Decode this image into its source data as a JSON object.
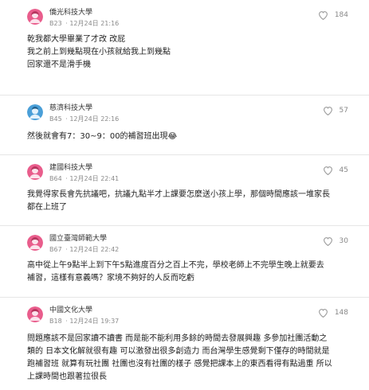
{
  "comments": [
    {
      "school": "僑光科技大學",
      "floor": "B23",
      "time": "12月24日 21:16",
      "likes": "184",
      "avatar": "pink-female-avatar",
      "lines": [
        "乾我都大學畢業了才改 改屁",
        "我之前上到幾點現在小孩就給我上到幾點",
        "回家還不是滑手機"
      ]
    },
    {
      "school": "慈濟科技大學",
      "floor": "B45",
      "time": "12月24日 22:16",
      "likes": "57",
      "avatar": "blue-male-avatar",
      "lines": [
        "然後就會有7：30~9：00的補習班出現😂"
      ]
    },
    {
      "school": "建國科技大學",
      "floor": "B64",
      "time": "12月24日 22:41",
      "likes": "45",
      "avatar": "pink-female-avatar",
      "lines": [
        "我覺得家長會先抗議吧，抗議九點半才上課要怎麼送小孩上學，那個時間應該一堆家長",
        "都在上班了"
      ]
    },
    {
      "school": "國立臺灣師範大學",
      "floor": "B67",
      "time": "12月24日 22:42",
      "likes": "30",
      "avatar": "pink-female-avatar",
      "lines": [
        "高中從上午9點半上到下午5點進度百分之百上不完，學校老師上不完學生晚上就要去",
        "補習，這樣有意義嗎？家境不夠好的人反而吃虧"
      ]
    },
    {
      "school": "中國文化大學",
      "floor": "B18",
      "time": "12月24日 19:37",
      "likes": "148",
      "avatar": "pink-female-avatar",
      "lines": [
        "問題應該不是回家讀不讀書 而是能不能利用多餘的時間去發展興趣 多參加社團活動之",
        "類的 日本文化解就很有趣 可以激發出很多創造力 而台灣學生感覺剩下僅存的時間就是",
        "跑補習班 就算有玩社團 社團也沒有社團的樣子 感覺把課本上的東西看得有點過重 所以",
        "上課時間也跟著拉很長"
      ]
    }
  ],
  "colors": {
    "female_avatar": "#e95d8c",
    "male_avatar": "#4a9fd8",
    "divider": "#e6e6e6",
    "meta_text": "#8a8a8a"
  }
}
